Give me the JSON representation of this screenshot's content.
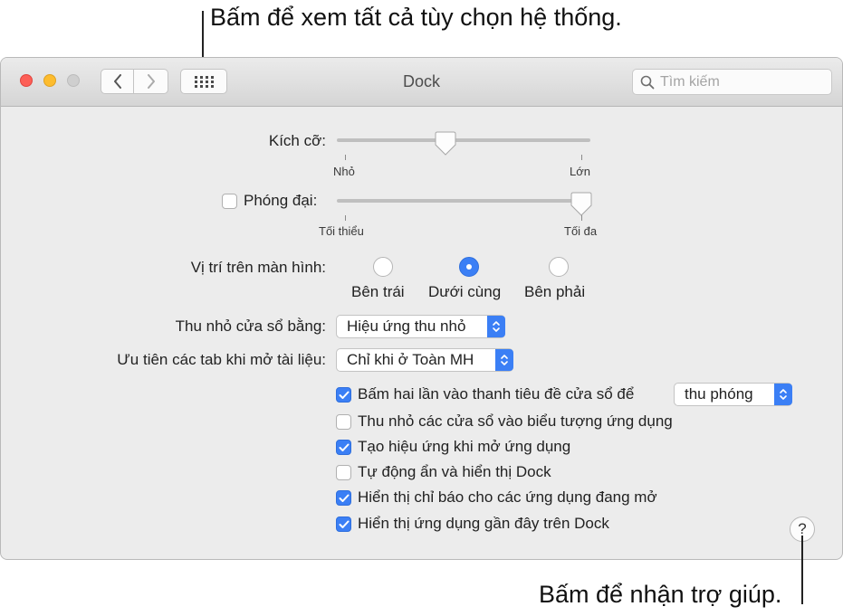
{
  "callouts": {
    "show_all": "Bấm để xem tất cả tùy chọn hệ thống.",
    "help": "Bấm để nhận trợ giúp."
  },
  "window": {
    "title": "Dock",
    "search_placeholder": "Tìm kiếm"
  },
  "size": {
    "label": "Kích cỡ:",
    "min_label": "Nhỏ",
    "max_label": "Lớn",
    "value_fraction": 0.43
  },
  "magnification": {
    "label": "Phóng đại:",
    "checked": false,
    "min_label": "Tối thiểu",
    "max_label": "Tối đa",
    "value_fraction": 1.0
  },
  "position": {
    "label": "Vị trí trên màn hình:",
    "options": [
      "Bên trái",
      "Dưới cùng",
      "Bên phải"
    ],
    "selected": "Dưới cùng"
  },
  "minimize": {
    "label": "Thu nhỏ cửa sổ bằng:",
    "value": "Hiệu ứng thu nhỏ"
  },
  "prefer_tabs": {
    "label": "Ưu tiên các tab khi mở tài liệu:",
    "value": "Chỉ khi ở Toàn MH"
  },
  "double_click": {
    "label": "Bấm hai lần vào thanh tiêu đề cửa sổ để",
    "checked": true,
    "value": "thu phóng"
  },
  "checkboxes": [
    {
      "label": "Thu nhỏ các cửa sổ vào biểu tượng ứng dụng",
      "checked": false
    },
    {
      "label": "Tạo hiệu ứng khi mở ứng dụng",
      "checked": true
    },
    {
      "label": "Tự động ẩn và hiển thị Dock",
      "checked": false
    },
    {
      "label": "Hiển thị chỉ báo cho các ứng dụng đang mở",
      "checked": true
    },
    {
      "label": "Hiển thị ứng dụng gần đây trên Dock",
      "checked": true
    }
  ],
  "help_button": "?"
}
